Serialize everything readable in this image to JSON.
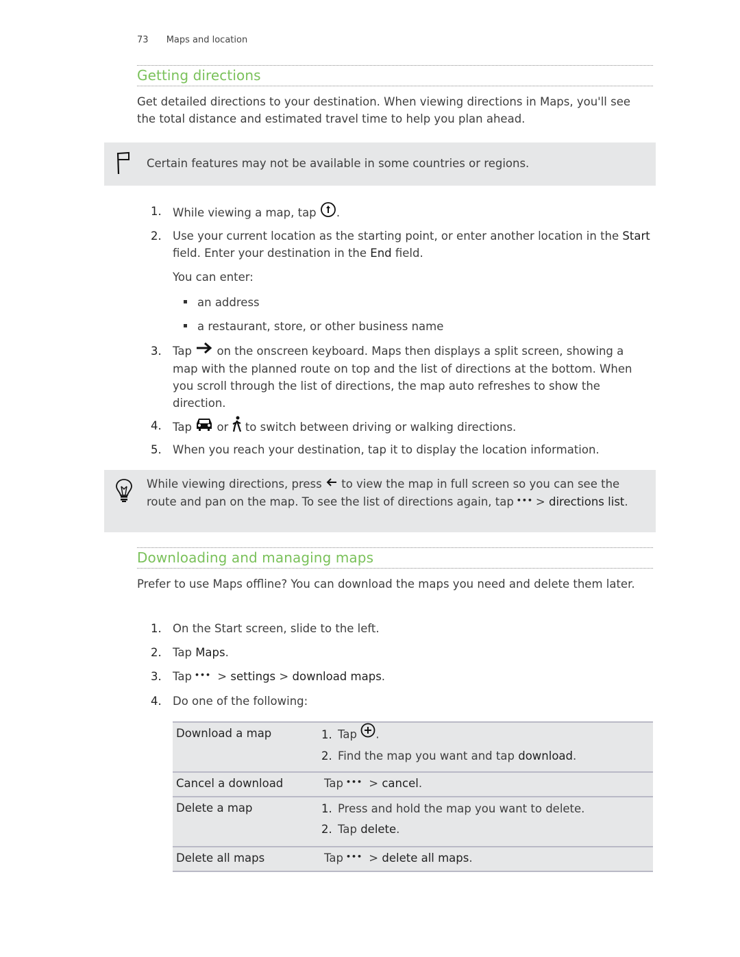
{
  "header": {
    "page_number": "73",
    "chapter": "Maps and location"
  },
  "section1": {
    "title": "Getting directions",
    "intro": "Get detailed directions to your destination. When viewing directions in Maps, you'll see the total distance and estimated travel time to help you plan ahead.",
    "note": {
      "icon": "flag-icon",
      "text": "Certain features may not be available in some countries or regions."
    },
    "steps": [
      {
        "num": "1.",
        "text_before": "While viewing a map, tap",
        "icon": "directions-icon",
        "text_after": "."
      },
      {
        "num": "2.",
        "part1": "Use your current location as the starting point, or enter another location in the",
        "start_term": "Start",
        "part2": "field. Enter your destination in the",
        "end_term": "End",
        "part3": "field.",
        "sub_intro": "You can enter:",
        "bullets": [
          "an address",
          "a restaurant, store, or other business name"
        ]
      },
      {
        "num": "3.",
        "text_before": "Tap",
        "icon": "arrow-right-icon",
        "text_after": "on the onscreen keyboard. Maps then displays a split screen, showing a map with the planned route on top and the list of directions at the bottom. When you scroll through the list of directions, the map auto refreshes to show the direction."
      },
      {
        "num": "4.",
        "text_before": "Tap",
        "icon1": "car-icon",
        "mid": "or",
        "icon2": "walking-icon",
        "text_after": "to switch between driving or walking directions."
      },
      {
        "num": "5.",
        "text": "When you reach your destination, tap it to display the location information."
      }
    ],
    "tip": {
      "icon": "lightbulb-icon",
      "part1": "While viewing directions, press",
      "icon_back": "back-arrow-icon",
      "part2": "to view the map in full screen so you can see the route and pan on the map. To see the list of directions again, tap",
      "icon_more": "more-icon",
      "more_glyph": "•••",
      "sep": ">",
      "term": "directions list",
      "end": "."
    }
  },
  "section2": {
    "title": "Downloading and managing maps",
    "intro": "Prefer to use Maps offline? You can download the maps you need and delete them later.",
    "steps": [
      {
        "num": "1.",
        "text": "On the Start screen, slide to the left."
      },
      {
        "num": "2.",
        "text_before": "Tap",
        "term": "Maps",
        "text_after": "."
      },
      {
        "num": "3.",
        "text_before": "Tap",
        "more_glyph": "•••",
        "sep1": ">",
        "term1": "settings",
        "sep2": ">",
        "term2": "download maps",
        "text_after": "."
      },
      {
        "num": "4.",
        "text": "Do one of the following:"
      }
    ],
    "table": [
      {
        "action": "Download a map",
        "sub": [
          {
            "num": "1.",
            "text_before": "Tap",
            "icon": "add-circle-icon",
            "text_after": "."
          },
          {
            "num": "2.",
            "text_before": "Find the map you want and tap",
            "term": "download",
            "text_after": "."
          }
        ]
      },
      {
        "action": "Cancel a download",
        "text_before": "Tap",
        "more_glyph": "•••",
        "sep": ">",
        "term": "cancel",
        "text_after": "."
      },
      {
        "action": "Delete a map",
        "sub": [
          {
            "num": "1.",
            "text": "Press and hold the map you want to delete."
          },
          {
            "num": "2.",
            "text_before": "Tap",
            "term": "delete",
            "text_after": "."
          }
        ]
      },
      {
        "action": "Delete all maps",
        "text_before": "Tap",
        "more_glyph": "•••",
        "sep": ">",
        "term": "delete all maps",
        "text_after": "."
      }
    ]
  },
  "colors": {
    "heading": "#7ac15a",
    "note_bg": "#e6e7e8",
    "table_rule": "#b9b9c6"
  }
}
